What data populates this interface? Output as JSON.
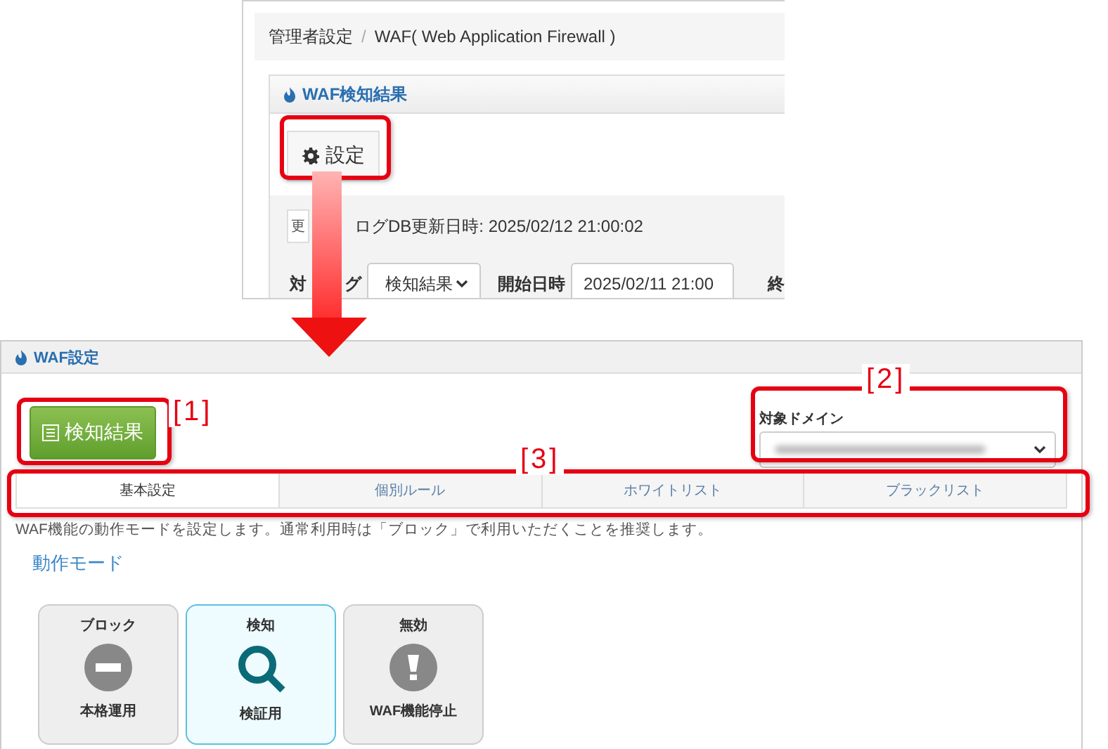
{
  "detection_screen": {
    "breadcrumb": [
      {
        "label": "管理者設定"
      },
      {
        "label": "WAF( Web Application Firewall )"
      }
    ],
    "separator": "/",
    "panel_title": "WAF検知結果",
    "settings_button": "設定",
    "update_button": "更",
    "db_updated": "ログDB更新日時: 2025/02/12 21:00:02",
    "log_label_parts": [
      "対",
      "グ"
    ],
    "log_select": "検知結果",
    "start_label": "開始日時",
    "start_value": "2025/02/11 21:00",
    "end_label": "終"
  },
  "settings_screen": {
    "panel_title": "WAF設定",
    "results_button": "検知結果",
    "domain_label": "対象ドメイン",
    "tabs": [
      {
        "label": "基本設定",
        "selected": true
      },
      {
        "label": "個別ルール",
        "selected": false
      },
      {
        "label": "ホワイトリスト",
        "selected": false
      },
      {
        "label": "ブラックリスト",
        "selected": false
      }
    ],
    "description": "WAF機能の動作モードを設定します。通常利用時は「ブロック」で利用いただくことを推奨します。",
    "section_title": "動作モード",
    "modes": [
      {
        "title": "ブロック",
        "kind": "block",
        "caption": "本格運用",
        "selected": false
      },
      {
        "title": "検知",
        "kind": "detect",
        "caption": "検証用",
        "selected": true
      },
      {
        "title": "無効",
        "kind": "disable",
        "caption": "WAF機能停止",
        "selected": false
      }
    ]
  },
  "annotations": [
    {
      "label": "[1]"
    },
    {
      "label": "[2]"
    },
    {
      "label": "[3]"
    }
  ]
}
